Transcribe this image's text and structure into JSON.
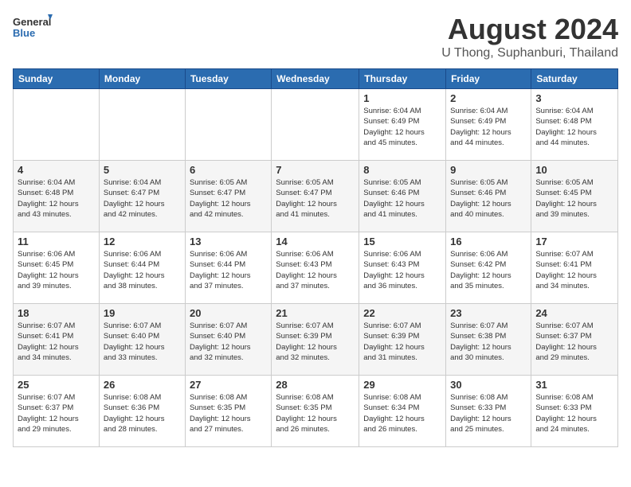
{
  "header": {
    "logo_line1": "General",
    "logo_line2": "Blue",
    "title": "August 2024",
    "subtitle": "U Thong, Suphanburi, Thailand"
  },
  "calendar": {
    "days_of_week": [
      "Sunday",
      "Monday",
      "Tuesday",
      "Wednesday",
      "Thursday",
      "Friday",
      "Saturday"
    ],
    "weeks": [
      [
        {
          "day": "",
          "info": ""
        },
        {
          "day": "",
          "info": ""
        },
        {
          "day": "",
          "info": ""
        },
        {
          "day": "",
          "info": ""
        },
        {
          "day": "1",
          "info": "Sunrise: 6:04 AM\nSunset: 6:49 PM\nDaylight: 12 hours\nand 45 minutes."
        },
        {
          "day": "2",
          "info": "Sunrise: 6:04 AM\nSunset: 6:49 PM\nDaylight: 12 hours\nand 44 minutes."
        },
        {
          "day": "3",
          "info": "Sunrise: 6:04 AM\nSunset: 6:48 PM\nDaylight: 12 hours\nand 44 minutes."
        }
      ],
      [
        {
          "day": "4",
          "info": "Sunrise: 6:04 AM\nSunset: 6:48 PM\nDaylight: 12 hours\nand 43 minutes."
        },
        {
          "day": "5",
          "info": "Sunrise: 6:04 AM\nSunset: 6:47 PM\nDaylight: 12 hours\nand 42 minutes."
        },
        {
          "day": "6",
          "info": "Sunrise: 6:05 AM\nSunset: 6:47 PM\nDaylight: 12 hours\nand 42 minutes."
        },
        {
          "day": "7",
          "info": "Sunrise: 6:05 AM\nSunset: 6:47 PM\nDaylight: 12 hours\nand 41 minutes."
        },
        {
          "day": "8",
          "info": "Sunrise: 6:05 AM\nSunset: 6:46 PM\nDaylight: 12 hours\nand 41 minutes."
        },
        {
          "day": "9",
          "info": "Sunrise: 6:05 AM\nSunset: 6:46 PM\nDaylight: 12 hours\nand 40 minutes."
        },
        {
          "day": "10",
          "info": "Sunrise: 6:05 AM\nSunset: 6:45 PM\nDaylight: 12 hours\nand 39 minutes."
        }
      ],
      [
        {
          "day": "11",
          "info": "Sunrise: 6:06 AM\nSunset: 6:45 PM\nDaylight: 12 hours\nand 39 minutes."
        },
        {
          "day": "12",
          "info": "Sunrise: 6:06 AM\nSunset: 6:44 PM\nDaylight: 12 hours\nand 38 minutes."
        },
        {
          "day": "13",
          "info": "Sunrise: 6:06 AM\nSunset: 6:44 PM\nDaylight: 12 hours\nand 37 minutes."
        },
        {
          "day": "14",
          "info": "Sunrise: 6:06 AM\nSunset: 6:43 PM\nDaylight: 12 hours\nand 37 minutes."
        },
        {
          "day": "15",
          "info": "Sunrise: 6:06 AM\nSunset: 6:43 PM\nDaylight: 12 hours\nand 36 minutes."
        },
        {
          "day": "16",
          "info": "Sunrise: 6:06 AM\nSunset: 6:42 PM\nDaylight: 12 hours\nand 35 minutes."
        },
        {
          "day": "17",
          "info": "Sunrise: 6:07 AM\nSunset: 6:41 PM\nDaylight: 12 hours\nand 34 minutes."
        }
      ],
      [
        {
          "day": "18",
          "info": "Sunrise: 6:07 AM\nSunset: 6:41 PM\nDaylight: 12 hours\nand 34 minutes."
        },
        {
          "day": "19",
          "info": "Sunrise: 6:07 AM\nSunset: 6:40 PM\nDaylight: 12 hours\nand 33 minutes."
        },
        {
          "day": "20",
          "info": "Sunrise: 6:07 AM\nSunset: 6:40 PM\nDaylight: 12 hours\nand 32 minutes."
        },
        {
          "day": "21",
          "info": "Sunrise: 6:07 AM\nSunset: 6:39 PM\nDaylight: 12 hours\nand 32 minutes."
        },
        {
          "day": "22",
          "info": "Sunrise: 6:07 AM\nSunset: 6:39 PM\nDaylight: 12 hours\nand 31 minutes."
        },
        {
          "day": "23",
          "info": "Sunrise: 6:07 AM\nSunset: 6:38 PM\nDaylight: 12 hours\nand 30 minutes."
        },
        {
          "day": "24",
          "info": "Sunrise: 6:07 AM\nSunset: 6:37 PM\nDaylight: 12 hours\nand 29 minutes."
        }
      ],
      [
        {
          "day": "25",
          "info": "Sunrise: 6:07 AM\nSunset: 6:37 PM\nDaylight: 12 hours\nand 29 minutes."
        },
        {
          "day": "26",
          "info": "Sunrise: 6:08 AM\nSunset: 6:36 PM\nDaylight: 12 hours\nand 28 minutes."
        },
        {
          "day": "27",
          "info": "Sunrise: 6:08 AM\nSunset: 6:35 PM\nDaylight: 12 hours\nand 27 minutes."
        },
        {
          "day": "28",
          "info": "Sunrise: 6:08 AM\nSunset: 6:35 PM\nDaylight: 12 hours\nand 26 minutes."
        },
        {
          "day": "29",
          "info": "Sunrise: 6:08 AM\nSunset: 6:34 PM\nDaylight: 12 hours\nand 26 minutes."
        },
        {
          "day": "30",
          "info": "Sunrise: 6:08 AM\nSunset: 6:33 PM\nDaylight: 12 hours\nand 25 minutes."
        },
        {
          "day": "31",
          "info": "Sunrise: 6:08 AM\nSunset: 6:33 PM\nDaylight: 12 hours\nand 24 minutes."
        }
      ]
    ]
  }
}
